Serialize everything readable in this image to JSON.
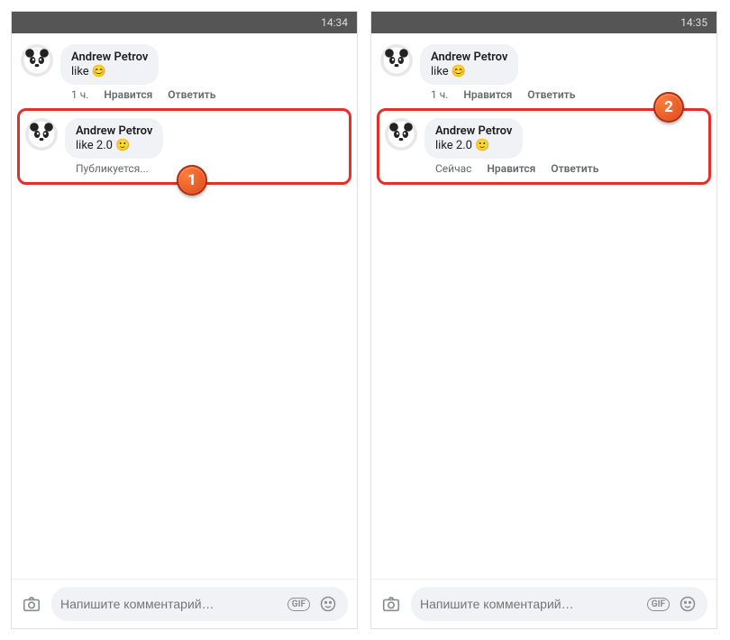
{
  "screens": [
    {
      "time": "14:34",
      "badge": "1",
      "comments": [
        {
          "author": "Andrew Petrov",
          "text": "like 😊",
          "meta": {
            "time": "1 ч.",
            "like": "Нравится",
            "reply": "Ответить"
          }
        },
        {
          "author": "Andrew Petrov",
          "text": "like 2.0 🙂",
          "meta": {
            "publishing": "Публикуется..."
          }
        }
      ],
      "composer": {
        "placeholder": "Напишите комментарий…",
        "gif": "GIF"
      }
    },
    {
      "time": "14:35",
      "badge": "2",
      "comments": [
        {
          "author": "Andrew Petrov",
          "text": "like 😊",
          "meta": {
            "time": "1 ч.",
            "like": "Нравится",
            "reply": "Ответить"
          }
        },
        {
          "author": "Andrew Petrov",
          "text": "like 2.0 🙂",
          "meta": {
            "time": "Сейчас",
            "like": "Нравится",
            "reply": "Ответить"
          }
        }
      ],
      "composer": {
        "placeholder": "Напишите комментарий…",
        "gif": "GIF"
      }
    }
  ]
}
